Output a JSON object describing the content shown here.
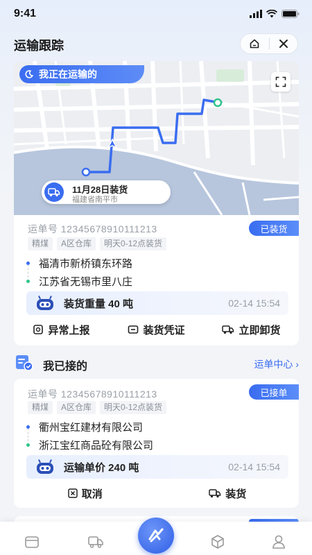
{
  "status_bar": {
    "time": "9:41"
  },
  "header": {
    "title": "运输跟踪"
  },
  "map": {
    "banner": "我正在运输的",
    "bubble_title": "11月28日装货",
    "bubble_subtitle": "福建省南平市"
  },
  "current_order": {
    "waybill": "运单号 12345678910111213",
    "status": "已装货",
    "tags": [
      "精煤",
      "A区仓库",
      "明天0-12点装货"
    ],
    "from": "福清市新桥镇东环路",
    "to": "江苏省无锡市里八庄",
    "info_label": "装货重量 40 吨",
    "info_time": "02-14 15:54",
    "actions": [
      "异常上报",
      "装货凭证",
      "立即卸货"
    ]
  },
  "section": {
    "title": "我已接的",
    "link": "运单中心"
  },
  "accepted_order": {
    "waybill": "运单号 12345678910111213",
    "status": "已接单",
    "tags": [
      "精煤",
      "A区仓库",
      "明天0-12点装货"
    ],
    "from": "衢州宝红建材有限公司",
    "to": "浙江宝红商品砼有限公司",
    "info_label": "运输单价 240 吨",
    "info_time": "02-14 15:54",
    "actions": [
      "取消",
      "装货"
    ]
  },
  "tabbar": {
    "tabs": [
      "找货",
      "跑货",
      "运营",
      "我的"
    ]
  },
  "colors": {
    "accent": "#3a6df0",
    "start_dot": "#3a6df0",
    "end_dot": "#2ec58a"
  }
}
